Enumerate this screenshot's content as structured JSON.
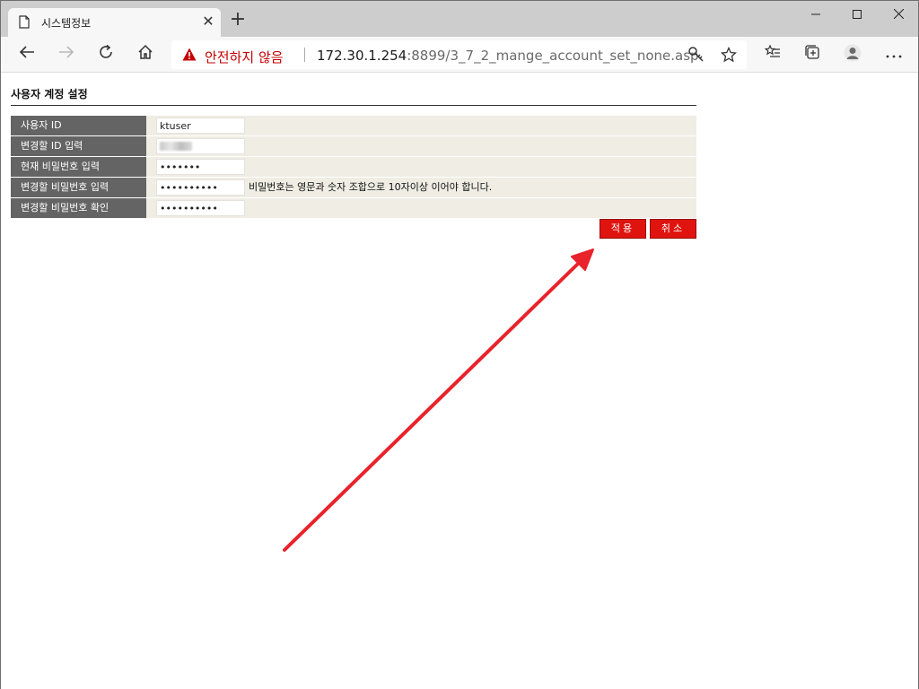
{
  "browser": {
    "tab_title": "시스템정보",
    "tab_close": "✕",
    "new_tab": "+",
    "security_label": "안전하지 않음",
    "url_host": "172.30.1.254",
    "url_rest": ":8899/3_7_2_mange_account_set_none.asp",
    "window_minimize": "—",
    "window_maximize": "☐",
    "window_close": "✕"
  },
  "page": {
    "title": "사용자 계정 설정",
    "rows": [
      {
        "label": "사용자 ID",
        "value": "ktuser",
        "type": "text"
      },
      {
        "label": "변경할 ID 입력",
        "value": "",
        "type": "text"
      },
      {
        "label": "현재 비밀번호 입력",
        "value": "•••••••",
        "type": "password"
      },
      {
        "label": "변경할 비밀번호 입력",
        "value": "••••••••••",
        "type": "password"
      },
      {
        "label": "변경할 비밀번호 확인",
        "value": "••••••••••",
        "type": "password"
      }
    ],
    "password_hint": "비밀번호는 영문과 숫자 조합으로 10자이상 이어야 합니다.",
    "apply_button": "적용",
    "cancel_button": "취소"
  },
  "colors": {
    "label_bg": "#646464",
    "field_bg": "#efede4",
    "button_red": "#e0140f",
    "annotation_arrow": "#e8232b"
  }
}
